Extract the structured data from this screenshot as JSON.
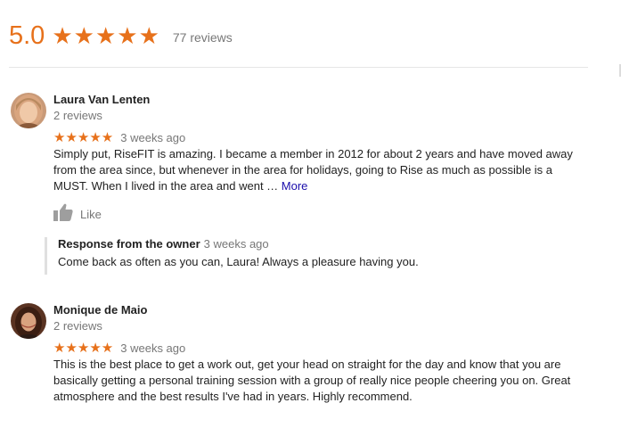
{
  "summary": {
    "rating": "5.0",
    "stars": "★★★★★",
    "reviews_count": "77 reviews"
  },
  "reviews": [
    {
      "name": "Laura Van Lenten",
      "reviews_count": "2 reviews",
      "stars": "★★★★★",
      "time": "3 weeks ago",
      "text": "Simply put, RiseFIT is amazing. I became a member in 2012 for about 2 years and have moved away from the area since, but whenever in the area for holidays, going to Rise as much as possible is a MUST. When I lived in the area and went … ",
      "more_label": "More",
      "like_label": "Like",
      "owner_response": {
        "title": "Response from the owner",
        "time": "3 weeks ago",
        "text": "Come back as often as you can, Laura! Always a pleasure having you."
      }
    },
    {
      "name": "Monique de Maio",
      "reviews_count": "2 reviews",
      "stars": "★★★★★",
      "time": "3 weeks ago",
      "text": "This is the best place to get a work out, get your head on straight for the day and know that you are basically getting a personal training session with a group of really nice people cheering you on.  Great atmosphere and the best results I've had in years. Highly recommend."
    }
  ],
  "colors": {
    "star": "#e7711b",
    "link": "#1a0dab",
    "muted": "#777777"
  }
}
